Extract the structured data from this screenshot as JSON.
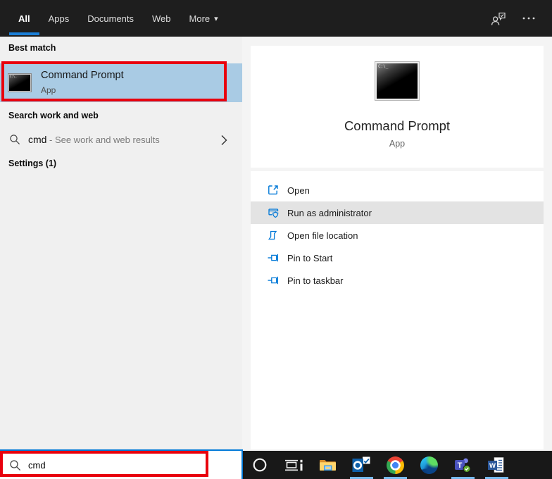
{
  "topbar": {
    "tabs": [
      {
        "label": "All",
        "active": true
      },
      {
        "label": "Apps",
        "active": false
      },
      {
        "label": "Documents",
        "active": false
      },
      {
        "label": "Web",
        "active": false
      },
      {
        "label": "More",
        "active": false,
        "has_caret": true
      }
    ],
    "caret": "▾"
  },
  "left_panel": {
    "sections": {
      "best_match": "Best match",
      "web_search": "Search work and web",
      "settings": "Settings (1)"
    },
    "best_match": {
      "title": "Command Prompt",
      "subtitle": "App",
      "icon": "command-prompt-icon"
    },
    "web_suggestion": {
      "query": "cmd",
      "hint": "- See work and web results",
      "icon": "search-icon"
    }
  },
  "preview_panel": {
    "title": "Command Prompt",
    "subtitle": "App",
    "icon": "command-prompt-icon",
    "actions": [
      {
        "label": "Open",
        "icon": "open-icon",
        "highlighted": false
      },
      {
        "label": "Run as administrator",
        "icon": "admin-shield-icon",
        "highlighted": true
      },
      {
        "label": "Open file location",
        "icon": "folder-icon",
        "highlighted": false
      },
      {
        "label": "Pin to Start",
        "icon": "pin-icon",
        "highlighted": false
      },
      {
        "label": "Pin to taskbar",
        "icon": "pin-icon",
        "highlighted": false
      }
    ]
  },
  "taskbar": {
    "search_value": "cmd",
    "icons": [
      {
        "name": "cortana",
        "open": false
      },
      {
        "name": "task-view",
        "open": false
      },
      {
        "name": "file-explorer",
        "open": false
      },
      {
        "name": "outlook",
        "open": true
      },
      {
        "name": "chrome",
        "open": true
      },
      {
        "name": "edge",
        "open": false
      },
      {
        "name": "teams",
        "open": true
      },
      {
        "name": "word",
        "open": true
      }
    ]
  },
  "annotation_color": "#e8000d",
  "accent_color": "#0078d7"
}
